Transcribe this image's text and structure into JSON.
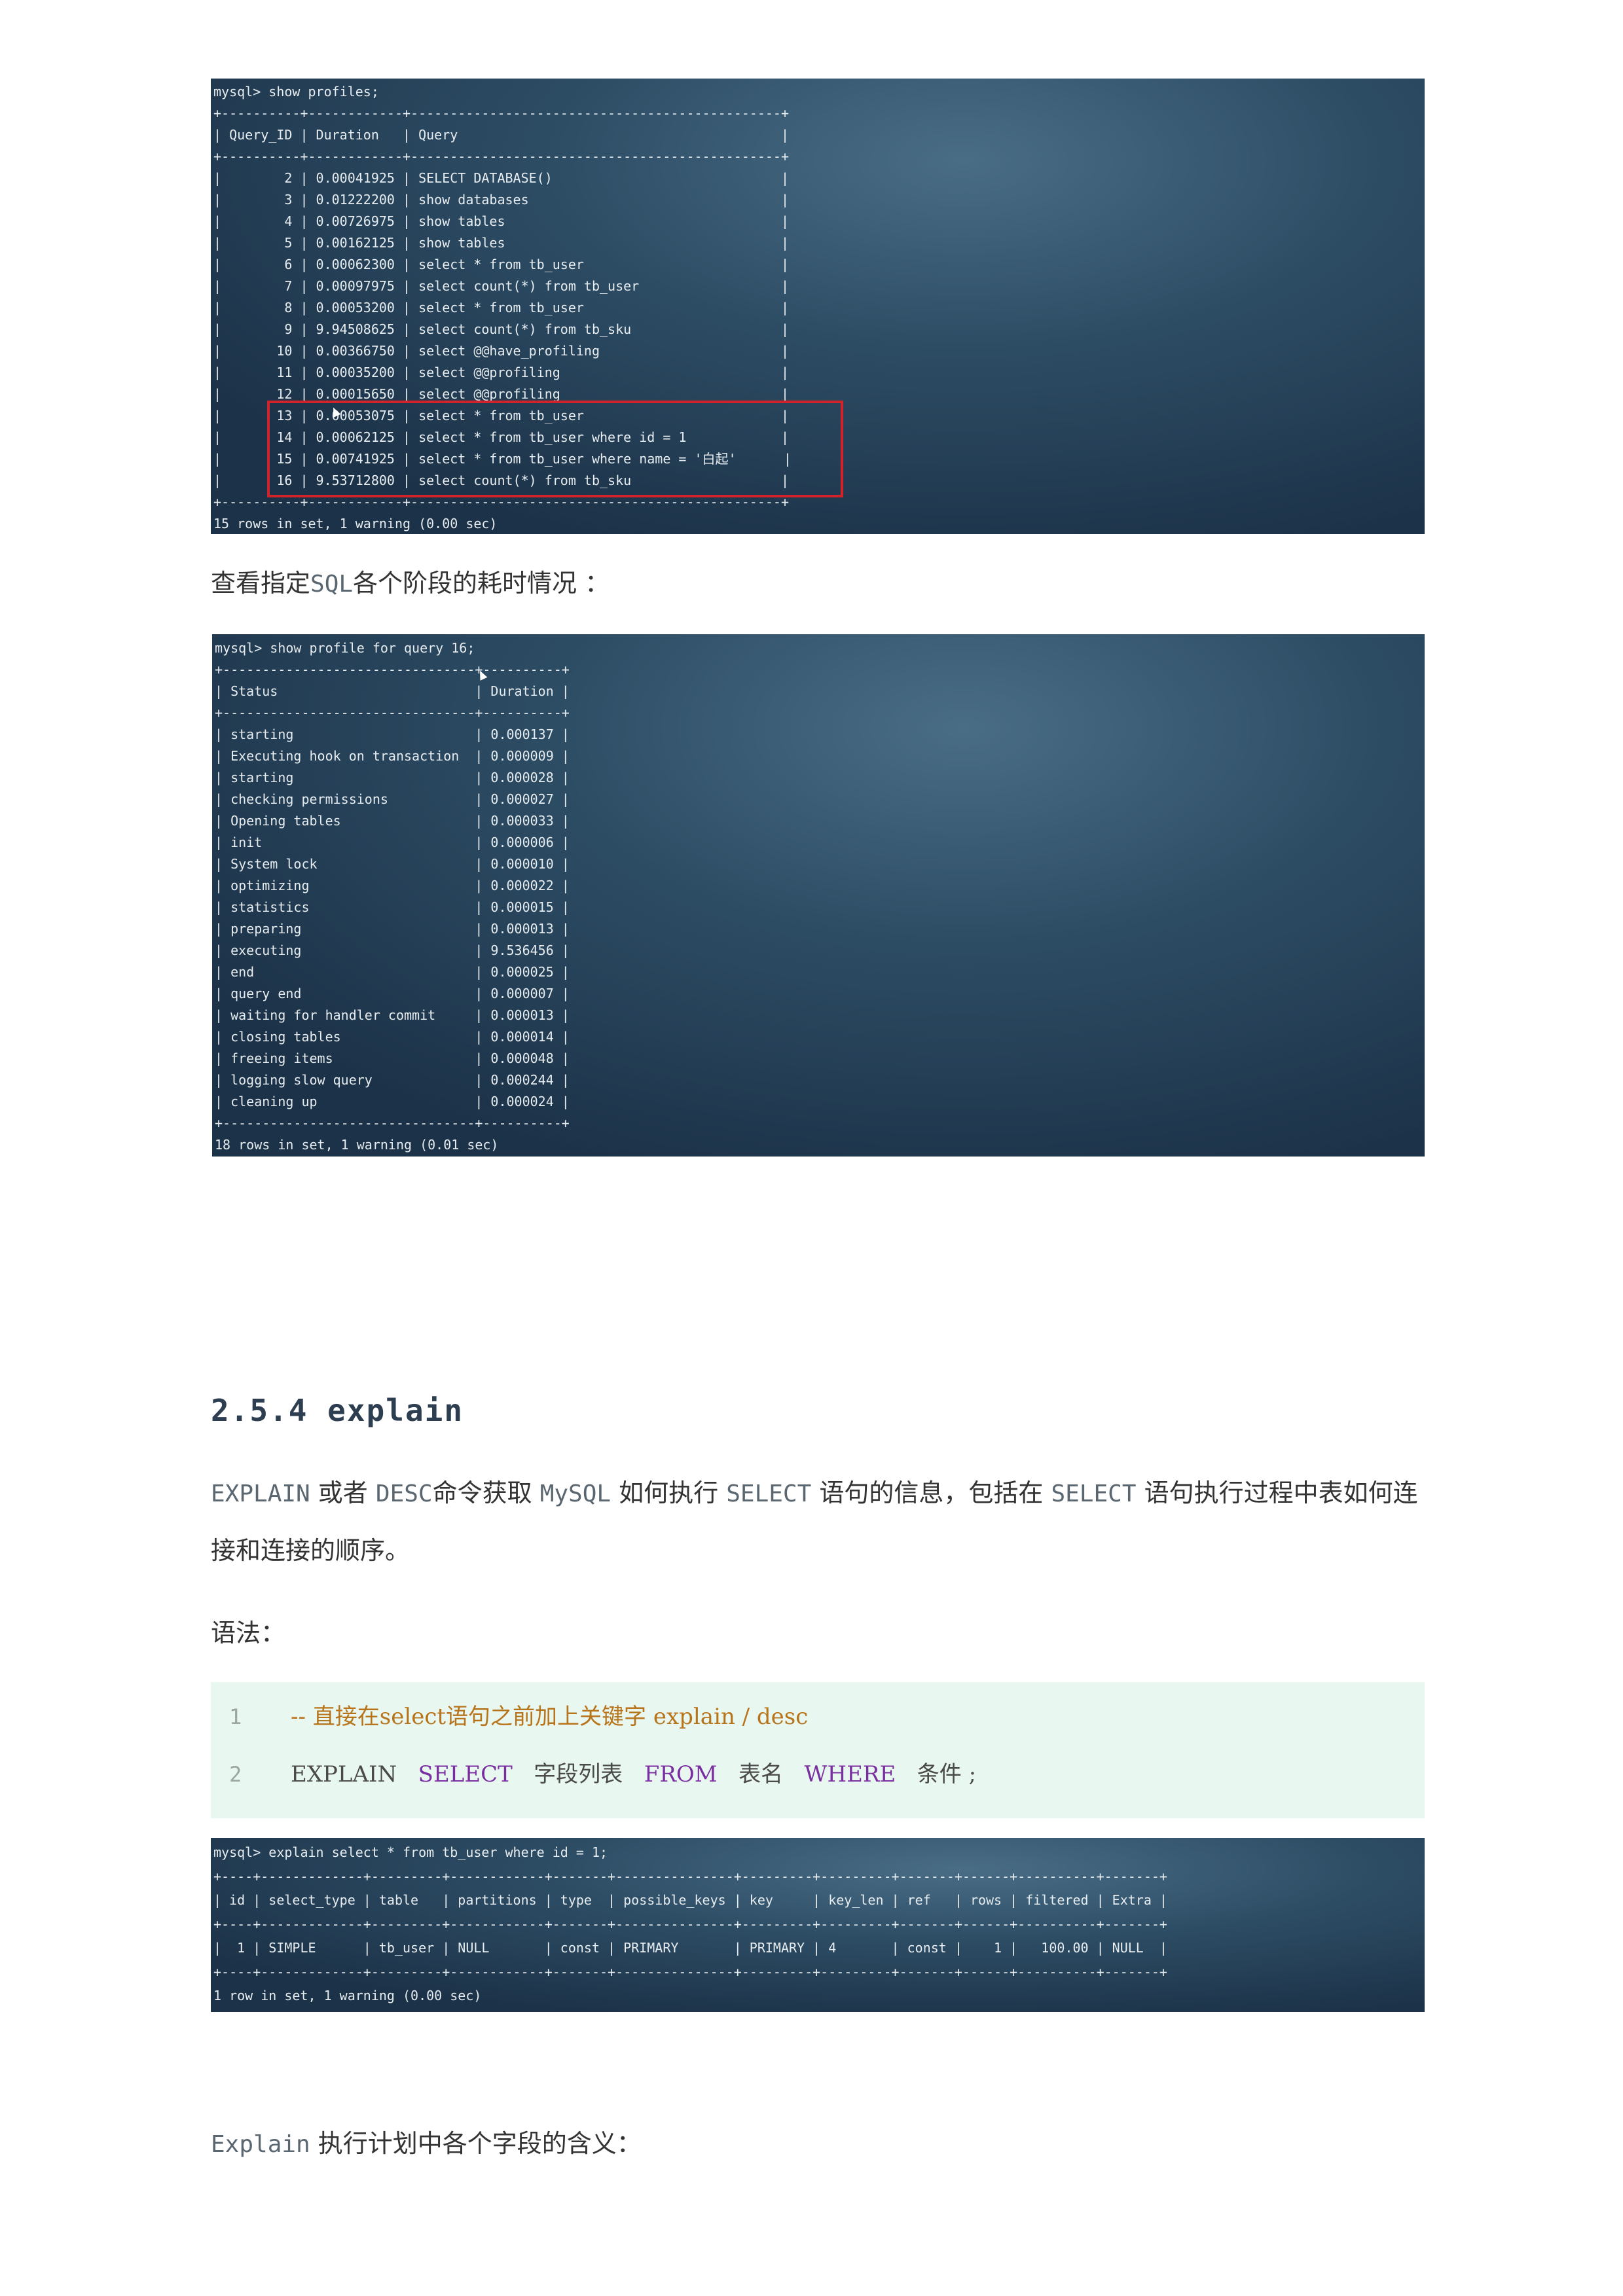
{
  "profiles_terminal": {
    "lines": [
      "mysql> show profiles;",
      "+----------+------------+-----------------------------------------------+",
      "| Query_ID | Duration   | Query                                         |",
      "+----------+------------+-----------------------------------------------+",
      "|        2 | 0.00041925 | SELECT DATABASE()                             |",
      "|        3 | 0.01222200 | show databases                                |",
      "|        4 | 0.00726975 | show tables                                   |",
      "|        5 | 0.00162125 | show tables                                   |",
      "|        6 | 0.00062300 | select * from tb_user                         |",
      "|        7 | 0.00097975 | select count(*) from tb_user                  |",
      "|        8 | 0.00053200 | select * from tb_user                         |",
      "|        9 | 9.94508625 | select count(*) from tb_sku                   |",
      "|       10 | 0.00366750 | select @@have_profiling                       |",
      "|       11 | 0.00035200 | select @@profiling                            |",
      "|       12 | 0.00015650 | select @@profiling                            |",
      "|       13 | 0.00053075 | select * from tb_user                         |",
      "|       14 | 0.00062125 | select * from tb_user where id = 1            |",
      "|       15 | 0.00741925 | select * from tb_user where name = '白起'      |",
      "|       16 | 9.53712800 | select count(*) from tb_sku                   |",
      "+----------+------------+-----------------------------------------------+",
      "15 rows in set, 1 warning (0.00 sec)"
    ]
  },
  "para_profile_label": {
    "prefix": "查看指定",
    "code": "SQL",
    "suffix": "各个阶段的耗时情况 ："
  },
  "profile_terminal": {
    "lines": [
      "mysql> show profile for query 16;",
      "+--------------------------------+----------+",
      "| Status                         | Duration |",
      "+--------------------------------+----------+",
      "| starting                       | 0.000137 |",
      "| Executing hook on transaction  | 0.000009 |",
      "| starting                       | 0.000028 |",
      "| checking permissions           | 0.000027 |",
      "| Opening tables                 | 0.000033 |",
      "| init                           | 0.000006 |",
      "| System lock                    | 0.000010 |",
      "| optimizing                     | 0.000022 |",
      "| statistics                     | 0.000015 |",
      "| preparing                      | 0.000013 |",
      "| executing                      | 9.536456 |",
      "| end                            | 0.000025 |",
      "| query end                      | 0.000007 |",
      "| waiting for handler commit     | 0.000013 |",
      "| closing tables                 | 0.000014 |",
      "| freeing items                  | 0.000048 |",
      "| logging slow query             | 0.000244 |",
      "| cleaning up                    | 0.000024 |",
      "+--------------------------------+----------+",
      "18 rows in set, 1 warning (0.01 sec)"
    ]
  },
  "heading": "2.5.4 explain",
  "para_explain": {
    "c1": "EXPLAIN",
    "t1": " 或者 ",
    "c2": "DESC",
    "t2": "命令获取 ",
    "c3": "MySQL",
    "t3": " 如何执行 ",
    "c4": "SELECT",
    "t4": " 语句的信息，包括在 ",
    "c5": "SELECT",
    "t5": " 语句执行过程中表如何连接和连接的顺序。"
  },
  "para_syntax": "语法：",
  "code_block": {
    "line1_no": "1",
    "line1_comment": "-- 直接在select语句之前加上关键字 explain / desc",
    "line2_no": "2",
    "line2_explain": "EXPLAIN",
    "line2_select": "SELECT",
    "line2_fields": "字段列表",
    "line2_from": "FROM",
    "line2_table": "表名",
    "line2_where": "WHERE",
    "line2_cond": "条件 ;"
  },
  "explain_terminal": {
    "lines": [
      "mysql> explain select * from tb_user where id = 1;",
      "+----+-------------+---------+------------+-------+---------------+---------+---------+-------+------+----------+-------+",
      "| id | select_type | table   | partitions | type  | possible_keys | key     | key_len | ref   | rows | filtered | Extra |",
      "+----+-------------+---------+------------+-------+---------------+---------+---------+-------+------+----------+-------+",
      "|  1 | SIMPLE      | tb_user | NULL       | const | PRIMARY       | PRIMARY | 4       | const |    1 |   100.00 | NULL  |",
      "+----+-------------+---------+------------+-------+---------------+---------+---------+-------+------+----------+-------+",
      "1 row in set, 1 warning (0.00 sec)"
    ]
  },
  "para_fields": {
    "code": "Explain",
    "text": " 执行计划中各个字段的含义："
  }
}
